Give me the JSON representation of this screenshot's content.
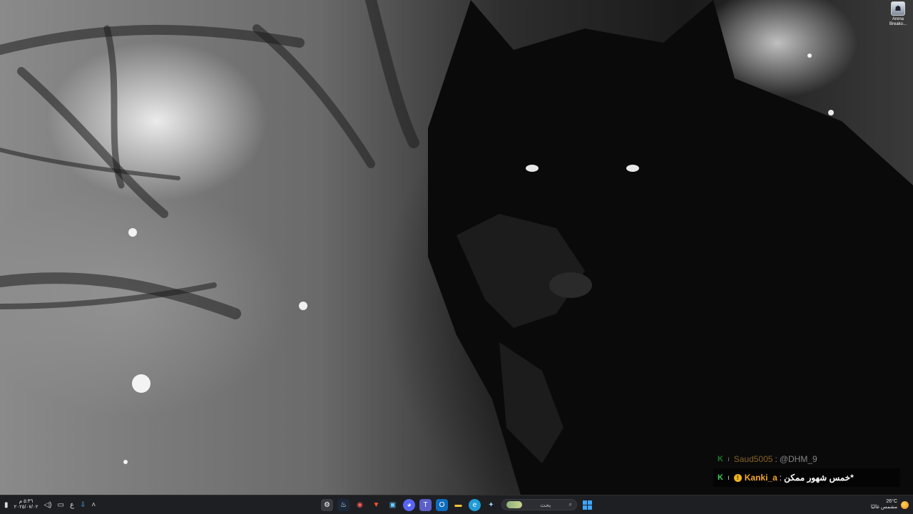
{
  "desktop": {
    "icons": [
      {
        "label": "Arena Breako...",
        "icon": "game-shortcut-icon"
      }
    ]
  },
  "chat_overlay": {
    "messages": [
      {
        "badge": "K",
        "mod_mark": "ı",
        "user": "Saud5005",
        "separator": ":",
        "message": "@DHM_9",
        "faded": true
      },
      {
        "badge": "K",
        "mod_mark": "ı",
        "coin": "!",
        "user": "Kanki_a",
        "separator": ":",
        "message": "خمس شهور ممكن*",
        "faded": false
      }
    ]
  },
  "taskbar": {
    "clock": {
      "time": "٥:٣٦ م",
      "date": "٢٠٢٥/٠٧/٠٢"
    },
    "tray": {
      "lang": "ع"
    },
    "search": {
      "placeholder": "بحث"
    },
    "weather": {
      "temp": "26°C",
      "condition": "مشمس غالبًا"
    },
    "apps": [
      {
        "name": "settings-icon",
        "glyph": "⚙"
      },
      {
        "name": "steam-icon",
        "glyph": "♨"
      },
      {
        "name": "obs-icon",
        "glyph": "◉"
      },
      {
        "name": "brave-icon",
        "glyph": "▼"
      },
      {
        "name": "terminal-icon",
        "glyph": "▣"
      },
      {
        "name": "discord-icon",
        "glyph": "◕"
      },
      {
        "name": "teams-icon",
        "glyph": "T"
      },
      {
        "name": "outlook-icon",
        "glyph": "O"
      },
      {
        "name": "file-explorer-icon",
        "glyph": "▬"
      },
      {
        "name": "edge-icon",
        "glyph": "e"
      },
      {
        "name": "copilot-icon",
        "glyph": "✦"
      }
    ]
  },
  "colors": {
    "taskbar_bg": "#1e1f22",
    "start_blue": "#3da4ff",
    "chat_username": "#e8a83a",
    "chat_badge": "#39d353"
  }
}
